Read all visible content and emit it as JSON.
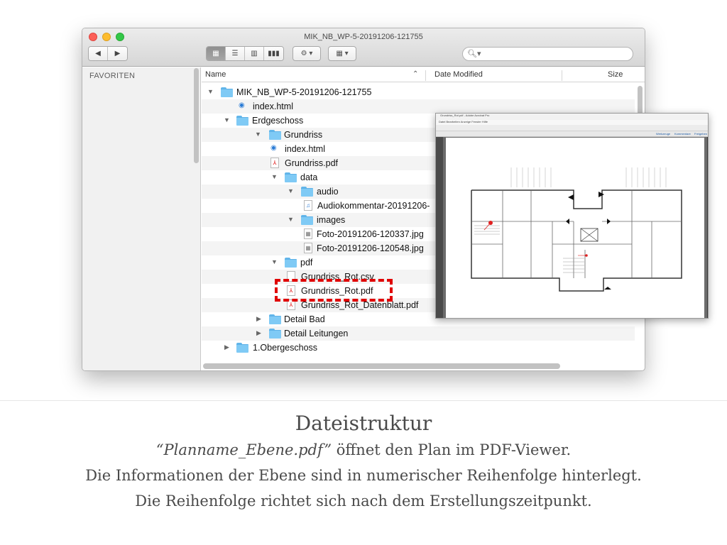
{
  "window": {
    "title": "MIK_NB_WP-5-20191206-121755"
  },
  "toolbar": {
    "nav_back": "◀",
    "nav_forward": "▶",
    "views": [
      "▦",
      "☰",
      "▥",
      "▮▮▮"
    ],
    "action_icon": "gear-icon",
    "arrange_icon": "grid-icon",
    "search_placeholder": ""
  },
  "sidebar": {
    "section": "FAVORITEN"
  },
  "columns": {
    "name": "Name",
    "date_modified": "Date Modified",
    "size": "Size"
  },
  "files": [
    {
      "name": "MIK_NB_WP-5-20191206-121755",
      "type": "folder",
      "expanded": true
    },
    {
      "name": "index.html",
      "type": "html"
    },
    {
      "name": "Erdgeschoss",
      "type": "folder",
      "expanded": true
    },
    {
      "name": "Grundriss",
      "type": "folder",
      "expanded": true
    },
    {
      "name": "index.html",
      "type": "html"
    },
    {
      "name": "Grundriss.pdf",
      "type": "pdf"
    },
    {
      "name": "data",
      "type": "folder",
      "expanded": true
    },
    {
      "name": "audio",
      "type": "folder",
      "expanded": true
    },
    {
      "name": "Audiokommentar-20191206-",
      "type": "audio"
    },
    {
      "name": "images",
      "type": "folder",
      "expanded": true
    },
    {
      "name": "Foto-20191206-120337.jpg",
      "type": "image"
    },
    {
      "name": "Foto-20191206-120548.jpg",
      "type": "image"
    },
    {
      "name": "pdf",
      "type": "folder",
      "expanded": true
    },
    {
      "name": "Grundriss_Rot.csv",
      "type": "file"
    },
    {
      "name": "Grundriss_Rot.pdf",
      "type": "pdf",
      "highlighted": true
    },
    {
      "name": "Grundriss_Rot_Datenblatt.pdf",
      "type": "pdf"
    },
    {
      "name": "Detail Bad",
      "type": "folder",
      "expanded": false
    },
    {
      "name": "Detail Leitungen",
      "type": "folder",
      "expanded": false
    },
    {
      "name": "1.Obergeschoss",
      "type": "folder",
      "expanded": false
    }
  ],
  "viewer": {
    "title": "Grundriss_Rot.pdf - Adobe Acrobat Pro",
    "menu": "Datei  Bearbeiten  Anzeige  Fenster  Hilfe",
    "tools": [
      "Werkzeuge",
      "Kommentare",
      "Freigeben"
    ]
  },
  "caption": {
    "title": "Dateistruktur",
    "line1_italic": "“Planname_Ebene.pdf”",
    "line1_rest": " öffnet den Plan im PDF-Viewer.",
    "line2": "Die Informationen der Ebene sind in numerischer Reihenfolge hinterlegt.",
    "line3": "Die Reihenfolge richtet sich nach dem Erstellungszeitpunkt."
  }
}
